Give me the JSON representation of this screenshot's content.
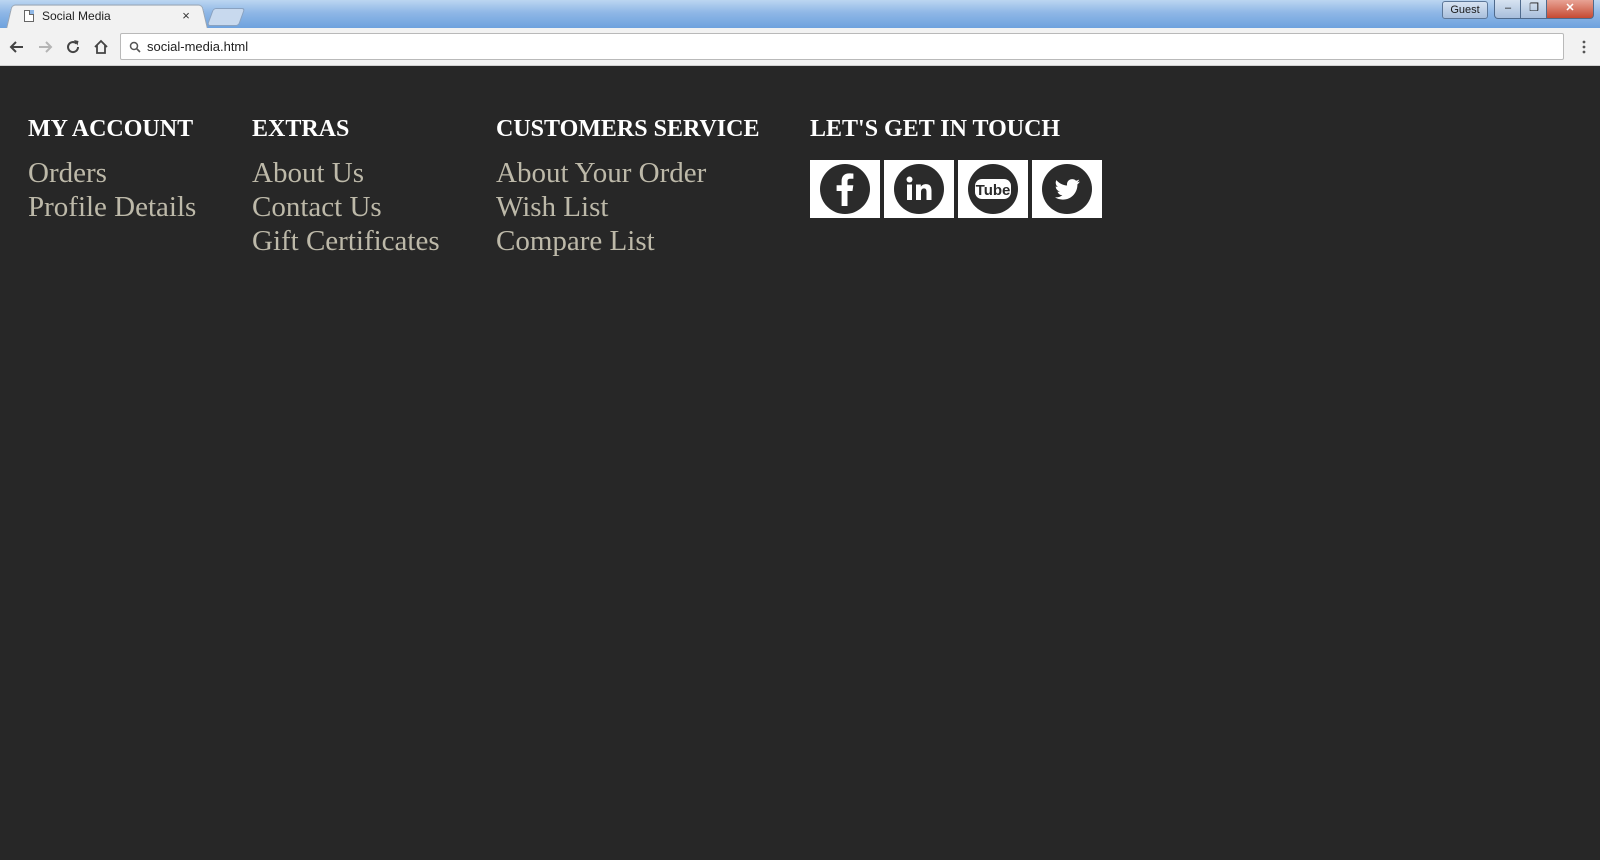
{
  "browser": {
    "tab_title": "Social Media",
    "tab_close": "×",
    "guest_label": "Guest",
    "window_min": "–",
    "window_max": "❐",
    "window_close": "✕",
    "address": "social-media.html"
  },
  "footer": {
    "columns": [
      {
        "title": "MY ACCOUNT",
        "links": [
          "Orders",
          "Profile Details"
        ]
      },
      {
        "title": "EXTRAS",
        "links": [
          "About Us",
          "Contact Us",
          "Gift Certificates"
        ]
      },
      {
        "title": "CUSTOMERS SERVICE",
        "links": [
          "About Your Order",
          "Wish List",
          "Compare List"
        ]
      },
      {
        "title": "LET'S GET IN TOUCH"
      }
    ],
    "social": [
      {
        "icon": "facebook-icon"
      },
      {
        "icon": "linkedin-icon"
      },
      {
        "icon": "youtube-icon",
        "text": "Tube"
      },
      {
        "icon": "twitter-icon"
      }
    ]
  },
  "colors": {
    "page_background": "#272727",
    "heading": "#ffffff",
    "link": "#bdb9a9",
    "icon_dark": "#2b2b2b"
  }
}
